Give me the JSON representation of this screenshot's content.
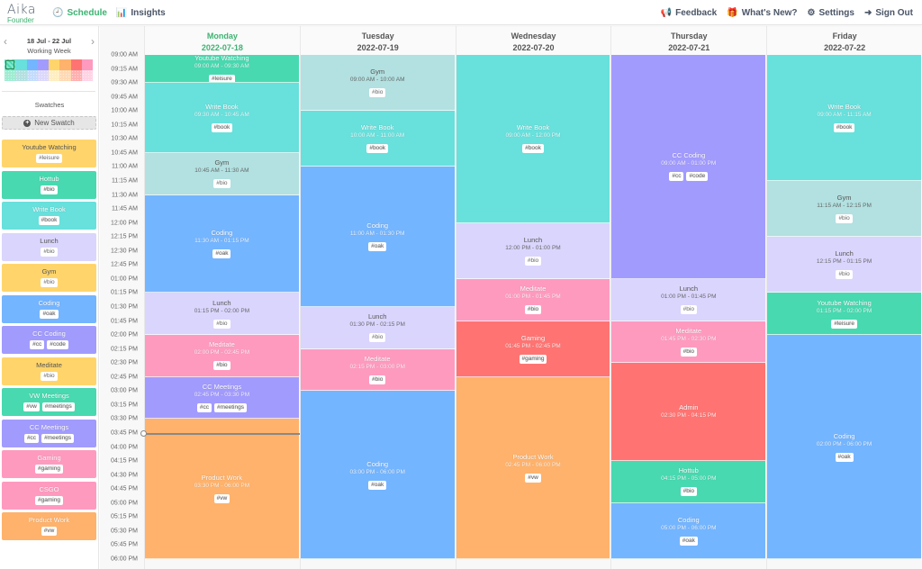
{
  "app": {
    "logo": "Aika",
    "logo_subtitle": "Founder"
  },
  "nav_left": [
    {
      "label": "Schedule",
      "icon": "clock-icon",
      "glyph": "🕘",
      "active": true
    },
    {
      "label": "Insights",
      "icon": "bar-chart-icon",
      "glyph": "📊",
      "active": false
    }
  ],
  "nav_right": [
    {
      "label": "Feedback",
      "icon": "megaphone-icon",
      "glyph": "📢"
    },
    {
      "label": "What's New?",
      "icon": "gift-icon",
      "glyph": "🎁"
    },
    {
      "label": "Settings",
      "icon": "gears-icon",
      "glyph": "⚙"
    },
    {
      "label": "Sign Out",
      "icon": "sign-out-icon",
      "glyph": "➜"
    }
  ],
  "sidebar": {
    "week_range": "18 Jul - 22 Jul",
    "week_label": "Working Week",
    "prev_glyph": "‹",
    "next_glyph": "›",
    "palette": [
      "#48d9b0",
      "#68e0dc",
      "#74b5ff",
      "#a29bfe",
      "#ffd56b",
      "#ffb26b",
      "#ff7472",
      "#ff9abf",
      "#a0ecd2",
      "#b3e0e0",
      "#c4dcfc",
      "#dcd8fc",
      "#ffeec0",
      "#ffd9b4",
      "#ffb0b0",
      "#ffd3e4"
    ],
    "palette_selected_index": 0,
    "swatches_title": "Swatches",
    "new_swatch_label": "New Swatch",
    "swatches": [
      {
        "name": "Youtube Watching",
        "tags": [
          "#leisure"
        ],
        "color": "#ffd56b",
        "text": "dark"
      },
      {
        "name": "Hottub",
        "tags": [
          "#bio"
        ],
        "color": "#48d9b0",
        "text": "light"
      },
      {
        "name": "Write Book",
        "tags": [
          "#book"
        ],
        "color": "#68e0dc",
        "text": "light"
      },
      {
        "name": "Lunch",
        "tags": [
          "#bio"
        ],
        "color": "#dad5fc",
        "text": "dark"
      },
      {
        "name": "Gym",
        "tags": [
          "#bio"
        ],
        "color": "#ffd56b",
        "text": "dark"
      },
      {
        "name": "Coding",
        "tags": [
          "#oak"
        ],
        "color": "#74b5ff",
        "text": "light"
      },
      {
        "name": "CC Coding",
        "tags": [
          "#cc",
          "#code"
        ],
        "color": "#a29bfe",
        "text": "light"
      },
      {
        "name": "Meditate",
        "tags": [
          "#bio"
        ],
        "color": "#ffd56b",
        "text": "dark"
      },
      {
        "name": "VW Meetings",
        "tags": [
          "#vw",
          "#meetings"
        ],
        "color": "#48d9b0",
        "text": "light"
      },
      {
        "name": "CC Meetings",
        "tags": [
          "#cc",
          "#meetings"
        ],
        "color": "#a29bfe",
        "text": "light"
      },
      {
        "name": "Gaming",
        "tags": [
          "#gaming"
        ],
        "color": "#ff9abf",
        "text": "light"
      },
      {
        "name": "CSGO",
        "tags": [
          "#gaming"
        ],
        "color": "#ff9abf",
        "text": "light"
      },
      {
        "name": "Product Work",
        "tags": [
          "#vw"
        ],
        "color": "#ffb26b",
        "text": "light"
      }
    ]
  },
  "calendar": {
    "time_labels": [
      "09:00 AM",
      "09:15 AM",
      "09:30 AM",
      "09:45 AM",
      "10:00 AM",
      "10:15 AM",
      "10:30 AM",
      "10:45 AM",
      "11:00 AM",
      "11:15 AM",
      "11:30 AM",
      "11:45 AM",
      "12:00 PM",
      "12:15 PM",
      "12:30 PM",
      "12:45 PM",
      "01:00 PM",
      "01:15 PM",
      "01:30 PM",
      "01:45 PM",
      "02:00 PM",
      "02:15 PM",
      "02:30 PM",
      "02:45 PM",
      "03:00 PM",
      "03:15 PM",
      "03:30 PM",
      "03:45 PM",
      "04:00 PM",
      "04:15 PM",
      "04:30 PM",
      "04:45 PM",
      "05:00 PM",
      "05:15 PM",
      "05:30 PM",
      "05:45 PM",
      "06:00 PM"
    ],
    "day_start_hour": 9,
    "day_end_hour": 18,
    "now_time": "03:45 PM",
    "now_hour": 15.75,
    "days": [
      {
        "name": "Monday",
        "date": "2022-07-18",
        "today": true,
        "events": [
          {
            "title": "Youtube Watching",
            "time": "09:00 AM - 09:30 AM",
            "start": 9.0,
            "end": 9.5,
            "tags": [
              "#leisure"
            ],
            "color": "#48d9b0",
            "text": "light"
          },
          {
            "title": "Write Book",
            "time": "09:30 AM - 10:45 AM",
            "start": 9.5,
            "end": 10.75,
            "tags": [
              "#book"
            ],
            "color": "#68e0dc",
            "text": "light"
          },
          {
            "title": "Gym",
            "time": "10:45 AM - 11:30 AM",
            "start": 10.75,
            "end": 11.5,
            "tags": [
              "#bio"
            ],
            "color": "#b3e0e0",
            "text": "dark"
          },
          {
            "title": "Coding",
            "time": "11:30 AM - 01:15 PM",
            "start": 11.5,
            "end": 13.25,
            "tags": [
              "#oak"
            ],
            "color": "#74b5ff",
            "text": "light"
          },
          {
            "title": "Lunch",
            "time": "01:15 PM - 02:00 PM",
            "start": 13.25,
            "end": 14.0,
            "tags": [
              "#bio"
            ],
            "color": "#dad5fc",
            "text": "dark"
          },
          {
            "title": "Meditate",
            "time": "02:00 PM - 02:45 PM",
            "start": 14.0,
            "end": 14.75,
            "tags": [
              "#bio"
            ],
            "color": "#ff9abf",
            "text": "light"
          },
          {
            "title": "CC Meetings",
            "time": "02:45 PM - 03:30 PM",
            "start": 14.75,
            "end": 15.5,
            "tags": [
              "#cc",
              "#meetings"
            ],
            "color": "#a29bfe",
            "text": "light"
          },
          {
            "title": "Product Work",
            "time": "03:30 PM - 06:00 PM",
            "start": 15.5,
            "end": 18.0,
            "tags": [
              "#vw"
            ],
            "color": "#ffb26b",
            "text": "light"
          }
        ]
      },
      {
        "name": "Tuesday",
        "date": "2022-07-19",
        "today": false,
        "events": [
          {
            "title": "Gym",
            "time": "09:00 AM - 10:00 AM",
            "start": 9.0,
            "end": 10.0,
            "tags": [
              "#bio"
            ],
            "color": "#b3e0e0",
            "text": "dark"
          },
          {
            "title": "Write Book",
            "time": "10:00 AM - 11:00 AM",
            "start": 10.0,
            "end": 11.0,
            "tags": [
              "#book"
            ],
            "color": "#68e0dc",
            "text": "light"
          },
          {
            "title": "Coding",
            "time": "11:00 AM - 01:30 PM",
            "start": 11.0,
            "end": 13.5,
            "tags": [
              "#oak"
            ],
            "color": "#74b5ff",
            "text": "light"
          },
          {
            "title": "Lunch",
            "time": "01:30 PM - 02:15 PM",
            "start": 13.5,
            "end": 14.25,
            "tags": [
              "#bio"
            ],
            "color": "#dad5fc",
            "text": "dark"
          },
          {
            "title": "Meditate",
            "time": "02:15 PM - 03:00 PM",
            "start": 14.25,
            "end": 15.0,
            "tags": [
              "#bio"
            ],
            "color": "#ff9abf",
            "text": "light"
          },
          {
            "title": "Coding",
            "time": "03:00 PM - 06:00 PM",
            "start": 15.0,
            "end": 18.0,
            "tags": [
              "#oak"
            ],
            "color": "#74b5ff",
            "text": "light"
          }
        ]
      },
      {
        "name": "Wednesday",
        "date": "2022-07-20",
        "today": false,
        "events": [
          {
            "title": "Write Book",
            "time": "09:00 AM - 12:00 PM",
            "start": 9.0,
            "end": 12.0,
            "tags": [
              "#book"
            ],
            "color": "#68e0dc",
            "text": "light"
          },
          {
            "title": "Lunch",
            "time": "12:00 PM - 01:00 PM",
            "start": 12.0,
            "end": 13.0,
            "tags": [
              "#bio"
            ],
            "color": "#dad5fc",
            "text": "dark"
          },
          {
            "title": "Meditate",
            "time": "01:00 PM - 01:45 PM",
            "start": 13.0,
            "end": 13.75,
            "tags": [
              "#bio"
            ],
            "color": "#ff9abf",
            "text": "light"
          },
          {
            "title": "Gaming",
            "time": "01:45 PM - 02:45 PM",
            "start": 13.75,
            "end": 14.75,
            "tags": [
              "#gaming"
            ],
            "color": "#ff7472",
            "text": "light"
          },
          {
            "title": "Product Work",
            "time": "02:45 PM - 06:00 PM",
            "start": 14.75,
            "end": 18.0,
            "tags": [
              "#vw"
            ],
            "color": "#ffb26b",
            "text": "light"
          }
        ]
      },
      {
        "name": "Thursday",
        "date": "2022-07-21",
        "today": false,
        "events": [
          {
            "title": "CC Coding",
            "time": "09:00 AM - 01:00 PM",
            "start": 9.0,
            "end": 13.0,
            "tags": [
              "#cc",
              "#code"
            ],
            "color": "#a29bfe",
            "text": "light"
          },
          {
            "title": "Lunch",
            "time": "01:00 PM - 01:45 PM",
            "start": 13.0,
            "end": 13.75,
            "tags": [
              "#bio"
            ],
            "color": "#dad5fc",
            "text": "dark"
          },
          {
            "title": "Meditate",
            "time": "01:45 PM - 02:30 PM",
            "start": 13.75,
            "end": 14.5,
            "tags": [
              "#bio"
            ],
            "color": "#ff9abf",
            "text": "light"
          },
          {
            "title": "Admin",
            "time": "02:30 PM - 04:15 PM",
            "start": 14.5,
            "end": 16.25,
            "tags": [],
            "color": "#ff7472",
            "text": "light"
          },
          {
            "title": "Hottub",
            "time": "04:15 PM - 05:00 PM",
            "start": 16.25,
            "end": 17.0,
            "tags": [
              "#bio"
            ],
            "color": "#48d9b0",
            "text": "light"
          },
          {
            "title": "Coding",
            "time": "05:00 PM - 06:00 PM",
            "start": 17.0,
            "end": 18.0,
            "tags": [
              "#oak"
            ],
            "color": "#74b5ff",
            "text": "light"
          }
        ]
      },
      {
        "name": "Friday",
        "date": "2022-07-22",
        "today": false,
        "events": [
          {
            "title": "Write Book",
            "time": "09:00 AM - 11:15 AM",
            "start": 9.0,
            "end": 11.25,
            "tags": [
              "#book"
            ],
            "color": "#68e0dc",
            "text": "light"
          },
          {
            "title": "Gym",
            "time": "11:15 AM - 12:15 PM",
            "start": 11.25,
            "end": 12.25,
            "tags": [
              "#bio"
            ],
            "color": "#b3e0e0",
            "text": "dark"
          },
          {
            "title": "Lunch",
            "time": "12:15 PM - 01:15 PM",
            "start": 12.25,
            "end": 13.25,
            "tags": [
              "#bio"
            ],
            "color": "#dad5fc",
            "text": "dark"
          },
          {
            "title": "Youtube Watching",
            "time": "01:15 PM - 02:00 PM",
            "start": 13.25,
            "end": 14.0,
            "tags": [
              "#leisure"
            ],
            "color": "#48d9b0",
            "text": "light"
          },
          {
            "title": "Coding",
            "time": "02:00 PM - 06:00 PM",
            "start": 14.0,
            "end": 18.0,
            "tags": [
              "#oak"
            ],
            "color": "#74b5ff",
            "text": "light"
          }
        ]
      }
    ]
  }
}
